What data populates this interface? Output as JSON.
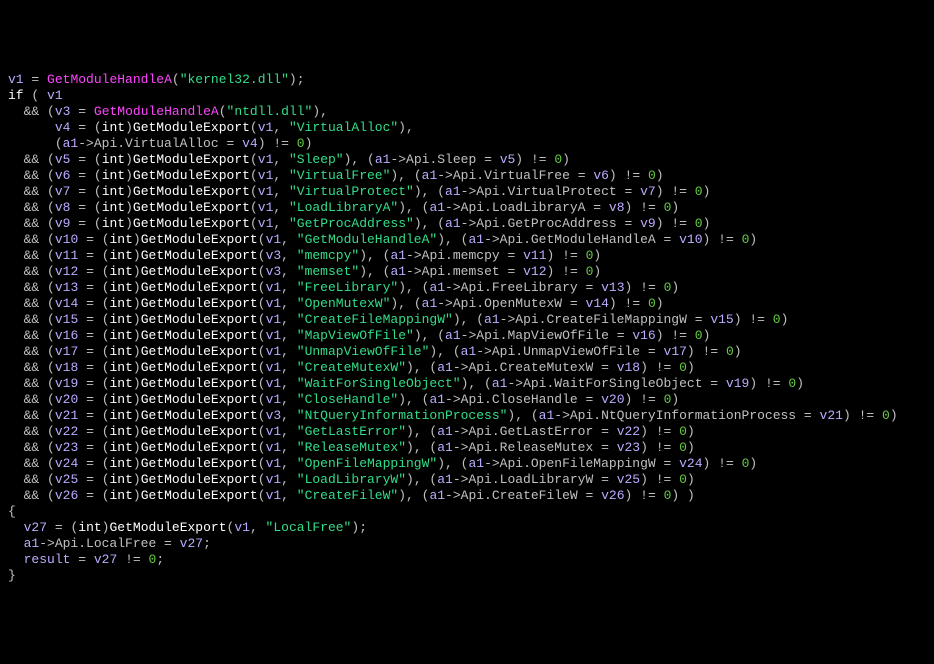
{
  "code": {
    "line1": {
      "v": "v1",
      "fn": "GetModuleHandleA",
      "arg": "\"kernel32.dll\""
    },
    "line2": {
      "kw": "if",
      "v": "v1"
    },
    "line3": {
      "v3": "v3",
      "fn": "GetModuleHandleA",
      "arg": "\"ntdll.dll\""
    },
    "line4": {
      "v": "v4",
      "fn": "GetModuleExport",
      "h": "v1",
      "s": "\"VirtualAlloc\""
    },
    "line5": {
      "api": "a1",
      "fld": "Api.VirtualAlloc",
      "v": "v4"
    },
    "exports": [
      {
        "v": "v5",
        "h": "v1",
        "s": "\"Sleep\"",
        "fld": "Api.Sleep"
      },
      {
        "v": "v6",
        "h": "v1",
        "s": "\"VirtualFree\"",
        "fld": "Api.VirtualFree"
      },
      {
        "v": "v7",
        "h": "v1",
        "s": "\"VirtualProtect\"",
        "fld": "Api.VirtualProtect"
      },
      {
        "v": "v8",
        "h": "v1",
        "s": "\"LoadLibraryA\"",
        "fld": "Api.LoadLibraryA"
      },
      {
        "v": "v9",
        "h": "v1",
        "s": "\"GetProcAddress\"",
        "fld": "Api.GetProcAddress"
      },
      {
        "v": "v10",
        "h": "v1",
        "s": "\"GetModuleHandleA\"",
        "fld": "Api.GetModuleHandleA"
      },
      {
        "v": "v11",
        "h": "v3",
        "s": "\"memcpy\"",
        "fld": "Api.memcpy"
      },
      {
        "v": "v12",
        "h": "v3",
        "s": "\"memset\"",
        "fld": "Api.memset"
      },
      {
        "v": "v13",
        "h": "v1",
        "s": "\"FreeLibrary\"",
        "fld": "Api.FreeLibrary"
      },
      {
        "v": "v14",
        "h": "v1",
        "s": "\"OpenMutexW\"",
        "fld": "Api.OpenMutexW"
      },
      {
        "v": "v15",
        "h": "v1",
        "s": "\"CreateFileMappingW\"",
        "fld": "Api.CreateFileMappingW"
      },
      {
        "v": "v16",
        "h": "v1",
        "s": "\"MapViewOfFile\"",
        "fld": "Api.MapViewOfFile"
      },
      {
        "v": "v17",
        "h": "v1",
        "s": "\"UnmapViewOfFile\"",
        "fld": "Api.UnmapViewOfFile"
      },
      {
        "v": "v18",
        "h": "v1",
        "s": "\"CreateMutexW\"",
        "fld": "Api.CreateMutexW"
      },
      {
        "v": "v19",
        "h": "v1",
        "s": "\"WaitForSingleObject\"",
        "fld": "Api.WaitForSingleObject"
      },
      {
        "v": "v20",
        "h": "v1",
        "s": "\"CloseHandle\"",
        "fld": "Api.CloseHandle"
      },
      {
        "v": "v21",
        "h": "v3",
        "s": "\"NtQueryInformationProcess\"",
        "fld": "Api.NtQueryInformationProcess"
      },
      {
        "v": "v22",
        "h": "v1",
        "s": "\"GetLastError\"",
        "fld": "Api.GetLastError"
      },
      {
        "v": "v23",
        "h": "v1",
        "s": "\"ReleaseMutex\"",
        "fld": "Api.ReleaseMutex"
      },
      {
        "v": "v24",
        "h": "v1",
        "s": "\"OpenFileMappingW\"",
        "fld": "Api.OpenFileMappingW"
      },
      {
        "v": "v25",
        "h": "v1",
        "s": "\"LoadLibraryW\"",
        "fld": "Api.LoadLibraryW"
      },
      {
        "v": "v26",
        "h": "v1",
        "s": "\"CreateFileW\"",
        "fld": "Api.CreateFileW"
      }
    ],
    "body": {
      "v27": "v27",
      "fn": "GetModuleExport",
      "h": "v1",
      "s": "\"LocalFree\"",
      "a1": "a1",
      "fld": "Api.LocalFree",
      "result": "result"
    },
    "tokens": {
      "int": "int",
      "zero": "0",
      "and": "&&",
      "neq": "!=",
      "eq": "=",
      "arrow": "->"
    }
  }
}
